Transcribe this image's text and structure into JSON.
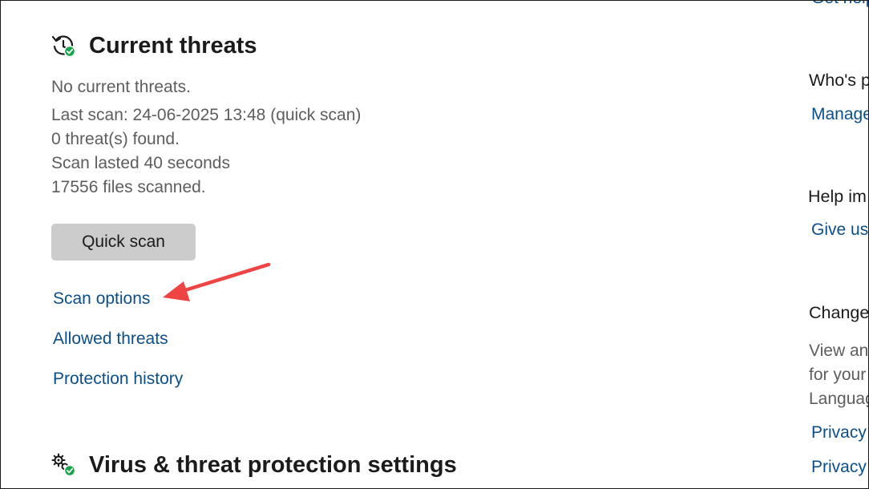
{
  "current_threats": {
    "title": "Current threats",
    "status": "No current threats.",
    "last_scan": "Last scan: 24-06-2025 13:48 (quick scan)",
    "threats_found": "0 threat(s) found.",
    "scan_duration": "Scan lasted 40 seconds",
    "files_scanned": "17556 files scanned.",
    "quick_scan_label": "Quick scan",
    "links": {
      "scan_options": "Scan options",
      "allowed_threats": "Allowed threats",
      "protection_history": "Protection history"
    },
    "icon": "history-check-icon"
  },
  "settings_section": {
    "title": "Virus & threat protection settings",
    "icon": "gears-check-icon"
  },
  "sidebar": {
    "top_link": "Get help",
    "whos_protecting": {
      "title": "Who's p",
      "link": "Manage"
    },
    "help_improve": {
      "title": "Help im",
      "link": "Give us"
    },
    "change_privacy": {
      "title": "Change",
      "text_lines": [
        "View an",
        "for your",
        "Languag"
      ],
      "links": [
        "Privacy s",
        "Privacy"
      ]
    }
  },
  "annotation": {
    "arrow_color": "#ef4444",
    "target": "Scan options"
  },
  "colors": {
    "link": "#0b4e8a",
    "body_text": "#5d5d5d",
    "button_bg": "#cccccc",
    "check_green": "#16a34a"
  }
}
